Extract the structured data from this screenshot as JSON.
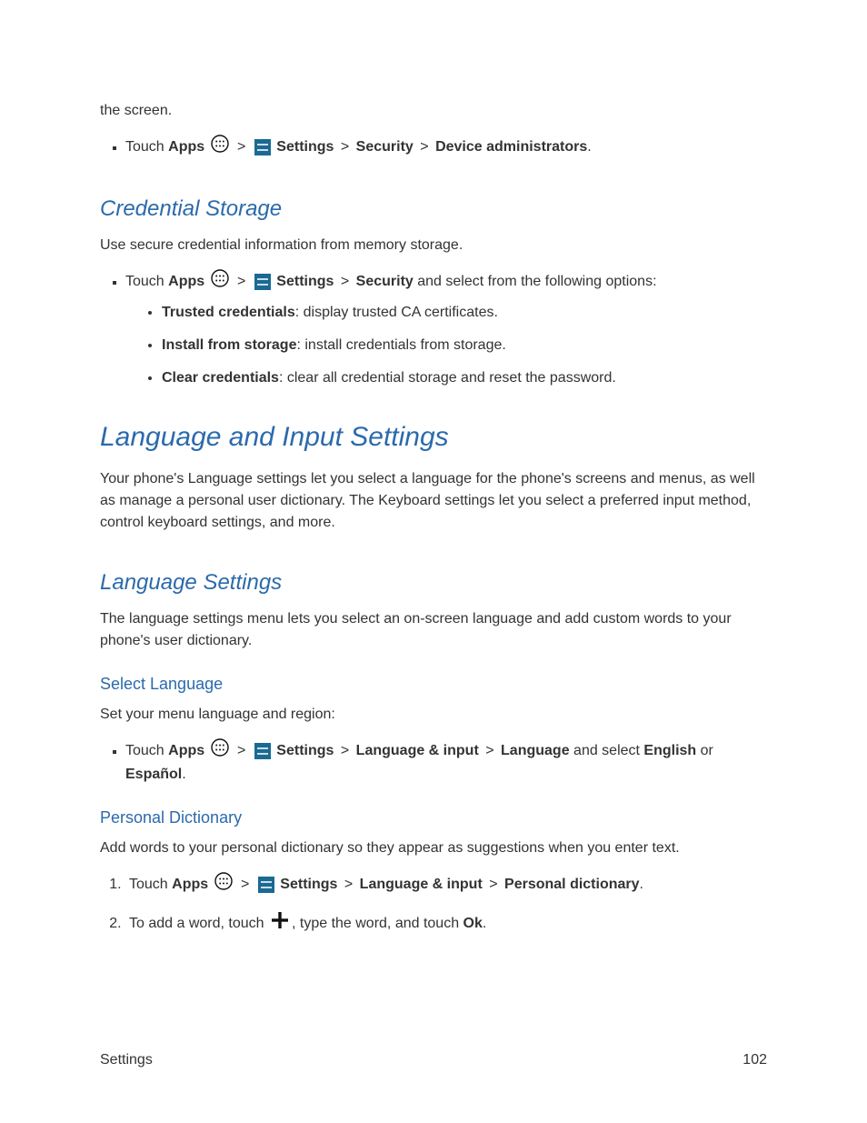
{
  "orphan_line": "the screen.",
  "gt": ">",
  "nav1": {
    "touch": "Touch ",
    "apps": "Apps",
    "settings": "Settings",
    "security": "Security",
    "device_admin": "Device administrators",
    "period": "."
  },
  "credential": {
    "heading": "Credential Storage",
    "intro": "Use secure credential information from memory storage.",
    "nav_touch": "Touch ",
    "nav_apps": "Apps",
    "nav_settings": "Settings",
    "nav_security": "Security",
    "nav_tail": " and select from the following options:",
    "opt1_b": "Trusted credentials",
    "opt1_rest": ": display trusted CA certificates.",
    "opt2_b": "Install from storage",
    "opt2_rest": ": install credentials from storage.",
    "opt3_b": "Clear credentials",
    "opt3_rest": ": clear all credential storage and reset the password."
  },
  "lang_input": {
    "heading": "Language and Input Settings",
    "intro": "Your phone's Language settings let you select a language for the phone's screens and menus, as well as manage a personal user dictionary. The Keyboard settings let you select a preferred input method, control keyboard settings, and more."
  },
  "lang_settings": {
    "heading": "Language Settings",
    "intro": "The language settings menu lets you select an on-screen language and add custom words to your phone's user dictionary."
  },
  "select_lang": {
    "heading": "Select Language",
    "intro": "Set your menu language and region:",
    "nav_touch": "Touch ",
    "nav_apps": "Apps",
    "nav_settings": "Settings",
    "nav_li": "Language & input",
    "nav_lang": "Language",
    "tail1": " and select ",
    "english": "English",
    "or": " or ",
    "espanol": "Español",
    "period": "."
  },
  "personal_dict": {
    "heading": "Personal Dictionary",
    "intro": "Add words to your personal dictionary so they appear as suggestions when you enter text.",
    "step1_touch": "Touch ",
    "step1_apps": "Apps",
    "step1_settings": "Settings",
    "step1_li": "Language & input",
    "step1_pd": "Personal dictionary",
    "step1_period": ".",
    "step2_a": "To add a word, touch ",
    "step2_b": ", type the word, and touch ",
    "step2_ok": "Ok",
    "step2_period": "."
  },
  "footer": {
    "left": "Settings",
    "right": "102"
  }
}
